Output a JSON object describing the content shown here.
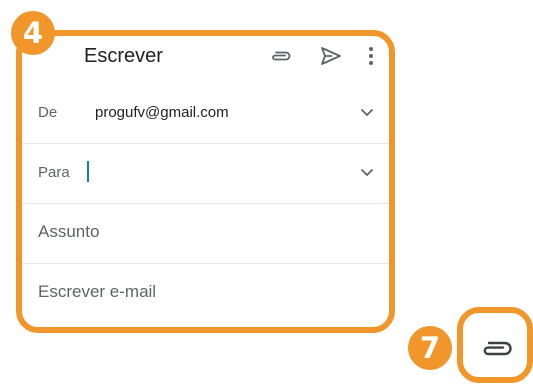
{
  "compose": {
    "title": "Escrever",
    "from_label": "De",
    "from_value": "progufv@gmail.com",
    "to_label": "Para",
    "to_value": "",
    "subject_placeholder": "Assunto",
    "body_placeholder": "Escrever e-mail"
  },
  "steps": {
    "compose_step": "4",
    "attach_step": "7"
  },
  "icons": {
    "attach": "paperclip-icon",
    "send": "send-icon",
    "more": "more-vertical-icon",
    "expand": "chevron-down-icon"
  },
  "colors": {
    "highlight": "#F0962A",
    "cursor": "#1a73e8",
    "icon": "#5f6368"
  }
}
